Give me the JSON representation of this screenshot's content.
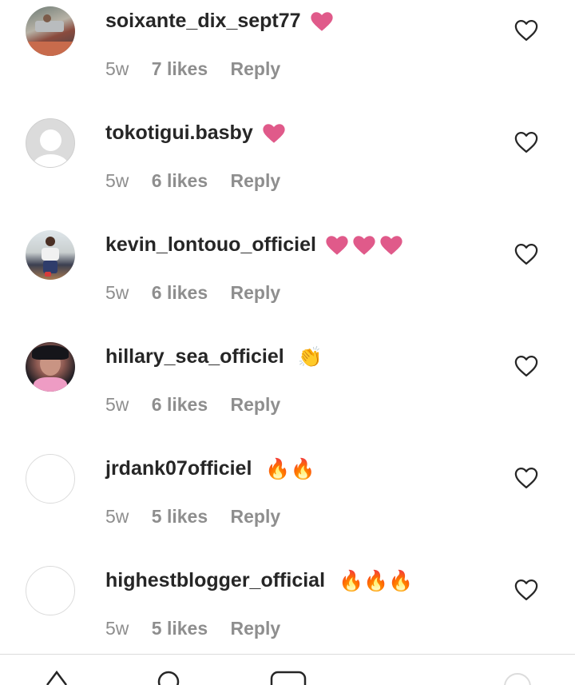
{
  "comments": [
    {
      "username": "soixante_dix_sept77",
      "emoji": "heart",
      "time": "5w",
      "likes": "7 likes",
      "reply": "Reply",
      "avatar": "photo-1"
    },
    {
      "username": "tokotigui.basby",
      "emoji": "heart",
      "time": "5w",
      "likes": "6 likes",
      "reply": "Reply",
      "avatar": "default"
    },
    {
      "username": "kevin_lontouo_officiel",
      "emoji": "heart x3",
      "time": "5w",
      "likes": "6 likes",
      "reply": "Reply",
      "avatar": "photo-3"
    },
    {
      "username": "hillary_sea_officiel",
      "emoji": "👏",
      "time": "5w",
      "likes": "6 likes",
      "reply": "Reply",
      "avatar": "photo-4"
    },
    {
      "username": "jrdank07officiel",
      "emoji": "🔥🔥",
      "time": "5w",
      "likes": "5 likes",
      "reply": "Reply",
      "avatar": "blank"
    },
    {
      "username": "highestblogger_official",
      "emoji": "🔥🔥🔥",
      "time": "5w",
      "likes": "5 likes",
      "reply": "Reply",
      "avatar": "blank"
    }
  ],
  "icons": {
    "like": "heart-outline-icon",
    "emoji_heart": "pink-heart-icon",
    "emoji_clap": "clapping-hands-icon",
    "emoji_fire": "fire-icon"
  },
  "colors": {
    "emoji_heart": "#e05a8a",
    "meta_text": "#8e8e8e",
    "username": "#262626"
  }
}
